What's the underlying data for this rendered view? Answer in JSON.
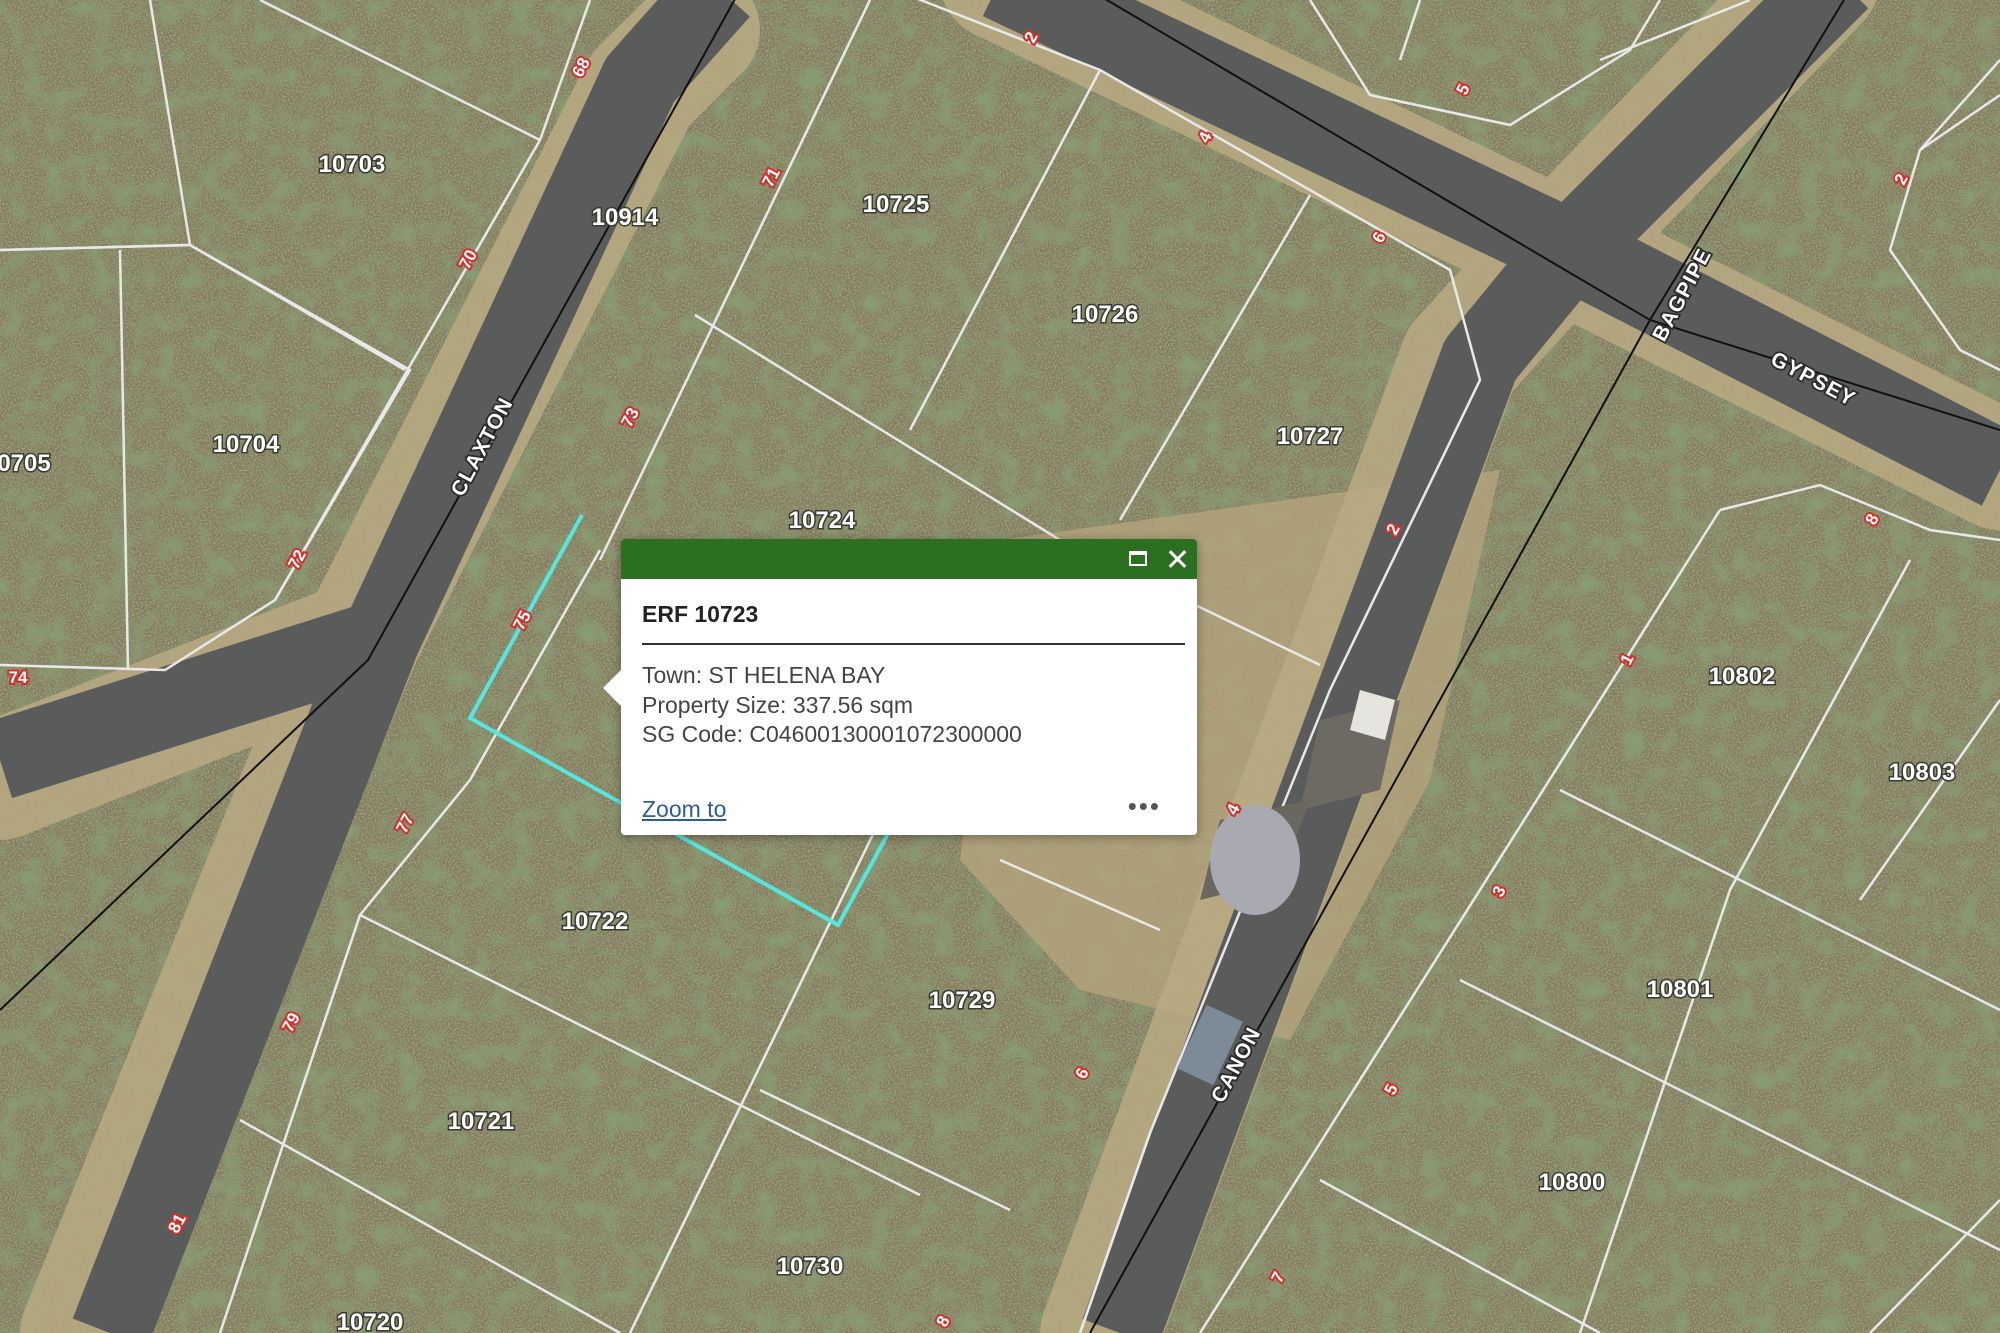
{
  "map": {
    "colors": {
      "terrain": "#807d5c",
      "vegetation": "#4a5a32",
      "sand": "#b5a47c",
      "road": "#5a5c5c",
      "parcel_line": "#e8e8e8",
      "selection": "#55e6e0",
      "house_number_bg": "#d0312d"
    },
    "streets": [
      "CLAXTON",
      "BAGPIPE",
      "GYPSEY",
      "CANON"
    ],
    "erf_labels": [
      "10703",
      "10914",
      "10725",
      "10726",
      "10727",
      "0705",
      "10704",
      "10724",
      "10802",
      "10803",
      "10801",
      "10722",
      "10729",
      "10721",
      "10800",
      "10730",
      "10720"
    ],
    "house_numbers": [
      "68",
      "70",
      "72",
      "74",
      "71",
      "73",
      "75",
      "77",
      "79",
      "81",
      "2",
      "4",
      "6",
      "5",
      "2",
      "8",
      "2",
      "4",
      "6",
      "8",
      "1",
      "3",
      "5",
      "7",
      "2"
    ]
  },
  "popup": {
    "header_color": "#2a7020",
    "title": "ERF 10723",
    "attributes": [
      "Town:  ST HELENA BAY",
      "Property Size: 337.56 sqm",
      "SG Code: C04600130001072300000"
    ],
    "zoom_link": "Zoom to",
    "more_label": "•••",
    "maximize_icon": "maximize-icon",
    "close_icon": "close-icon"
  }
}
